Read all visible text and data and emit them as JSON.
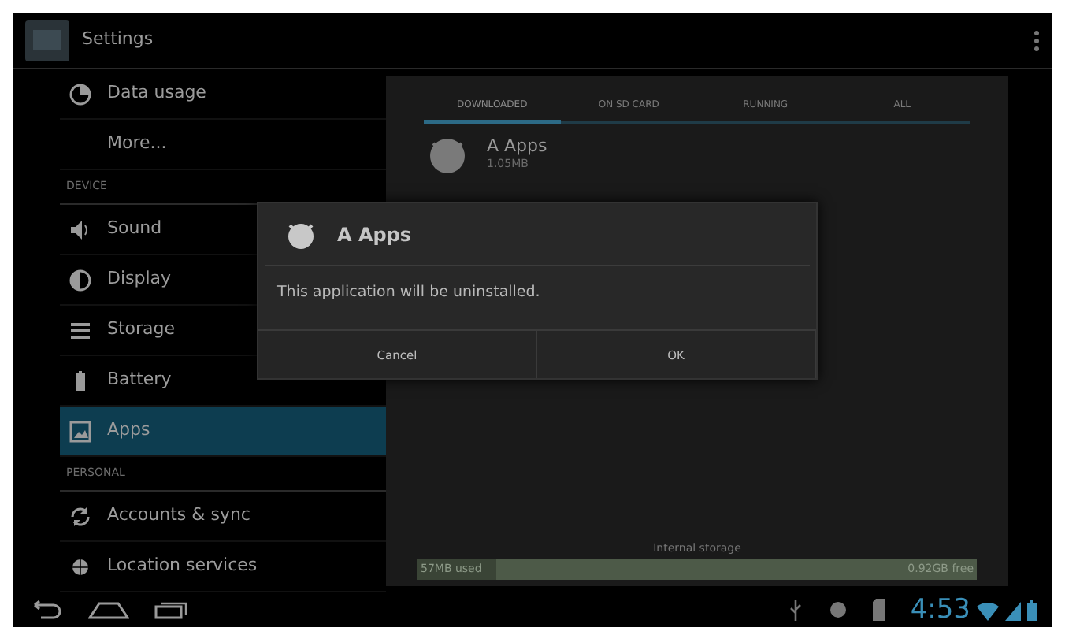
{
  "action_bar": {
    "title": "Settings"
  },
  "sidebar": {
    "items": [
      {
        "kind": "item",
        "label": "Data usage",
        "selected": false
      },
      {
        "kind": "item",
        "label": "More...",
        "selected": false
      },
      {
        "kind": "header",
        "label": "DEVICE"
      },
      {
        "kind": "item",
        "label": "Sound",
        "selected": false
      },
      {
        "kind": "item",
        "label": "Display",
        "selected": false
      },
      {
        "kind": "item",
        "label": "Storage",
        "selected": false
      },
      {
        "kind": "item",
        "label": "Battery",
        "selected": false
      },
      {
        "kind": "item",
        "label": "Apps",
        "selected": true
      },
      {
        "kind": "header",
        "label": "PERSONAL"
      },
      {
        "kind": "item",
        "label": "Accounts & sync",
        "selected": false
      },
      {
        "kind": "item",
        "label": "Location services",
        "selected": false
      }
    ]
  },
  "tabs": [
    {
      "label": "DOWNLOADED",
      "selected": true
    },
    {
      "label": "ON SD CARD",
      "selected": false
    },
    {
      "label": "RUNNING",
      "selected": false
    },
    {
      "label": "ALL",
      "selected": false
    }
  ],
  "apps": [
    {
      "name": "A Apps",
      "size": "1.05MB"
    }
  ],
  "storage": {
    "label": "Internal storage",
    "used": "57MB used",
    "free": "0.92GB free",
    "level": 0.14
  },
  "dialog": {
    "title": "A Apps",
    "message": "This application will be uninstalled.",
    "buttons": [
      "Cancel",
      "OK"
    ]
  },
  "status_bar": {
    "time": "4:53"
  }
}
